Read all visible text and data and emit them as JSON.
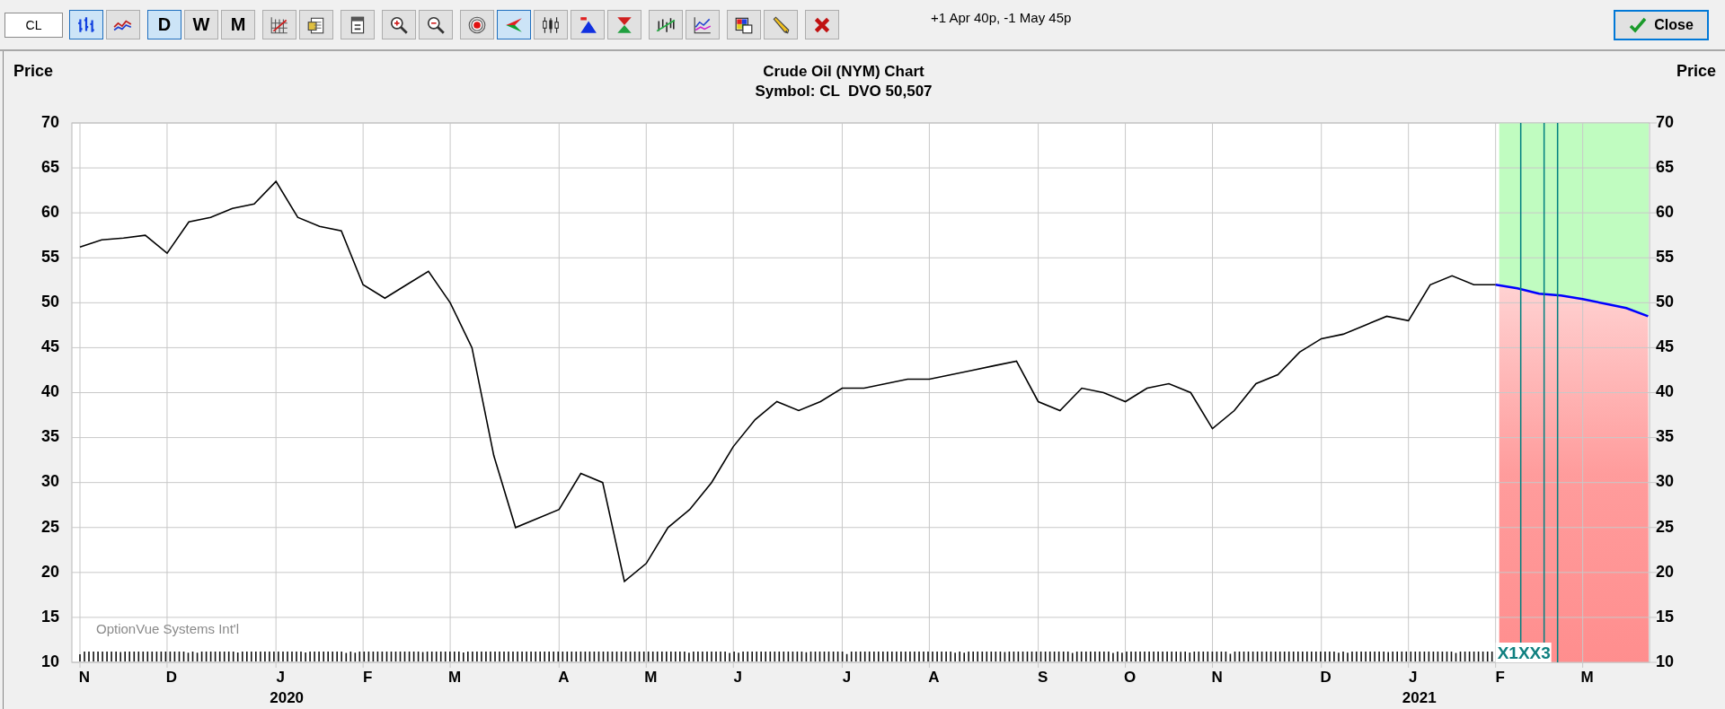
{
  "toolbar": {
    "symbol": "CL",
    "button_groups": [
      [
        {
          "kind": "icon",
          "selected": true
        },
        {
          "kind": "icon",
          "selected": false
        }
      ],
      [
        {
          "kind": "text",
          "label": "D",
          "selected": true
        },
        {
          "kind": "text",
          "label": "W",
          "selected": false
        },
        {
          "kind": "text",
          "label": "M",
          "selected": false
        }
      ],
      [
        {
          "kind": "icon",
          "selected": false
        },
        {
          "kind": "icon",
          "selected": false
        }
      ],
      [
        {
          "kind": "icon",
          "selected": false
        }
      ],
      [
        {
          "kind": "icon",
          "selected": false
        },
        {
          "kind": "icon",
          "selected": false
        }
      ],
      [
        {
          "kind": "icon",
          "selected": false
        },
        {
          "kind": "icon",
          "selected": true
        },
        {
          "kind": "icon",
          "selected": false
        },
        {
          "kind": "icon",
          "selected": false
        },
        {
          "kind": "icon",
          "selected": false
        }
      ],
      [
        {
          "kind": "icon",
          "selected": false
        },
        {
          "kind": "icon",
          "selected": false
        }
      ],
      [
        {
          "kind": "icon",
          "selected": false
        },
        {
          "kind": "icon",
          "selected": false
        }
      ],
      [
        {
          "kind": "icon",
          "selected": false
        }
      ]
    ],
    "position_text": "+1 Apr 40p, -1 May 45p",
    "close_button": "Close"
  },
  "chart": {
    "axis_label_right": "Price",
    "title": "Crude Oil (NYM) Chart",
    "subtitle": "Symbol: CL  DVO 50,507",
    "watermark_text": "OptionVue Systems Int'l",
    "expiration_label": "X1XX3",
    "year_labels": [
      "2020",
      "2021"
    ],
    "left_axis_labels": [
      "70",
      "65",
      "60",
      "55",
      "50",
      "45",
      "40",
      "35",
      "30",
      "25",
      "20",
      "15",
      "10"
    ],
    "chart_data": {
      "type": "line",
      "ylabel": "Price",
      "ylim": [
        10,
        70
      ],
      "grid": true,
      "categories": [
        "N",
        null,
        null,
        null,
        "D",
        null,
        null,
        null,
        null,
        "J",
        null,
        null,
        null,
        "F",
        null,
        null,
        null,
        "M",
        null,
        null,
        null,
        null,
        "A",
        null,
        null,
        null,
        "M",
        null,
        null,
        null,
        "J",
        null,
        null,
        null,
        null,
        "J",
        null,
        null,
        null,
        "A",
        null,
        null,
        null,
        null,
        "S",
        null,
        null,
        null,
        "O",
        null,
        null,
        null,
        "N",
        null,
        null,
        null,
        null,
        "D",
        null,
        null,
        null,
        "J",
        null,
        null,
        null,
        "F",
        null,
        null,
        null,
        "M",
        null,
        null,
        null
      ],
      "yticks": [
        10,
        15,
        20,
        25,
        30,
        35,
        40,
        45,
        50,
        55,
        60,
        65,
        70
      ],
      "series": [
        {
          "color": "#000000",
          "values": [
            56.2,
            57,
            57.2,
            57.5,
            55.5,
            59,
            59.5,
            60.5,
            61,
            63.5,
            59.5,
            58.5,
            58,
            52,
            50.5,
            52,
            53.5,
            50,
            45,
            33,
            25,
            26,
            27,
            31,
            30,
            19,
            21,
            25,
            27,
            30,
            34,
            37,
            39,
            38,
            39,
            40.5,
            40.5,
            41,
            41.5,
            41.5,
            42,
            42.5,
            43,
            43.5,
            39,
            38,
            40.5,
            40,
            39,
            40.5,
            41,
            40,
            36,
            38,
            41,
            42,
            44.5,
            46,
            46.5,
            47.5,
            48.5,
            48,
            52,
            53,
            52,
            52,
            null,
            null,
            null,
            null,
            null,
            null,
            null
          ]
        },
        {
          "color": "#0000ff",
          "values": [
            null,
            null,
            null,
            null,
            null,
            null,
            null,
            null,
            null,
            null,
            null,
            null,
            null,
            null,
            null,
            null,
            null,
            null,
            null,
            null,
            null,
            null,
            null,
            null,
            null,
            null,
            null,
            null,
            null,
            null,
            null,
            null,
            null,
            null,
            null,
            null,
            null,
            null,
            null,
            null,
            null,
            null,
            null,
            null,
            null,
            null,
            null,
            null,
            null,
            null,
            null,
            null,
            null,
            null,
            null,
            null,
            null,
            null,
            null,
            null,
            null,
            null,
            null,
            null,
            null,
            52,
            51.6,
            51,
            50.8,
            50.4,
            49.9,
            49.4,
            48.5
          ]
        }
      ]
    }
  }
}
